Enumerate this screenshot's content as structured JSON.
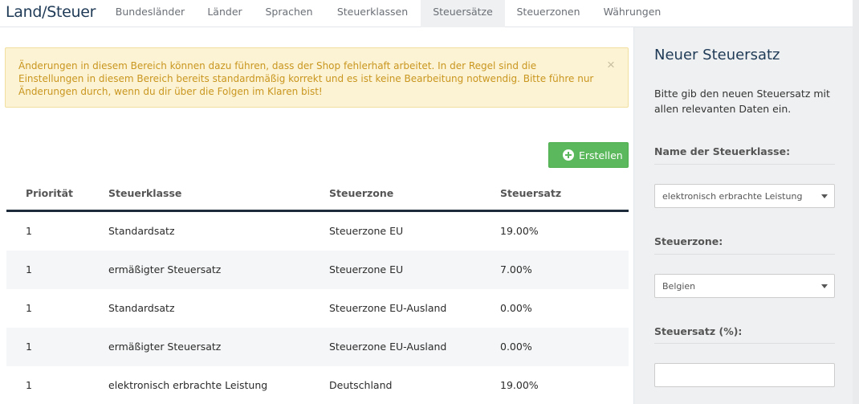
{
  "app_title": "Land/Steuer",
  "tabs": [
    {
      "label": "Bundesländer"
    },
    {
      "label": "Länder"
    },
    {
      "label": "Sprachen"
    },
    {
      "label": "Steuerklassen"
    },
    {
      "label": "Steuersätze"
    },
    {
      "label": "Steuerzonen"
    },
    {
      "label": "Währungen"
    }
  ],
  "active_tab": "Steuersätze",
  "alert": {
    "text": "Änderungen in diesem Bereich können dazu führen, dass der Shop fehlerhaft arbeitet. In der Regel sind die Einstellungen in diesem Bereich bereits standardmäßig korrekt und es ist keine Bearbeitung notwendig. Bitte führe nur Änderungen durch, wenn du dir über die Folgen im Klaren bist!",
    "close_glyph": "×"
  },
  "create_button": {
    "label": "Erstellen"
  },
  "table": {
    "headers": [
      "Priorität",
      "Steuerklasse",
      "Steuerzone",
      "Steuersatz"
    ],
    "rows": [
      [
        "1",
        "Standardsatz",
        "Steuerzone EU",
        "19.00%"
      ],
      [
        "1",
        "ermäßigter Steuersatz",
        "Steuerzone EU",
        "7.00%"
      ],
      [
        "1",
        "Standardsatz",
        "Steuerzone EU-Ausland",
        "0.00%"
      ],
      [
        "1",
        "ermäßigter Steuersatz",
        "Steuerzone EU-Ausland",
        "0.00%"
      ],
      [
        "1",
        "elektronisch erbrachte Leistung",
        "Deutschland",
        "19.00%"
      ]
    ]
  },
  "side_panel": {
    "title": "Neuer Steuersatz",
    "description": "Bitte gib den neuen Steuersatz mit allen relevanten Daten ein.",
    "tax_class_label": "Name der Steuerklasse:",
    "tax_class_value": "elektronisch erbrachte Leistung",
    "tax_zone_label": "Steuerzone:",
    "tax_zone_value": "Belgien",
    "tax_rate_label": "Steuersatz (%):",
    "tax_rate_value": ""
  },
  "colors": {
    "brand_title": "#1f3a56",
    "alert_bg": "#fcf3d4",
    "alert_text": "#c9961f",
    "success": "#5cb85c",
    "header_rule": "#1d2b3a",
    "panel_bg": "#eff0f1"
  },
  "icons": {
    "create": "plus-circle-icon",
    "close": "close-icon",
    "dropdown": "caret-down-icon"
  }
}
